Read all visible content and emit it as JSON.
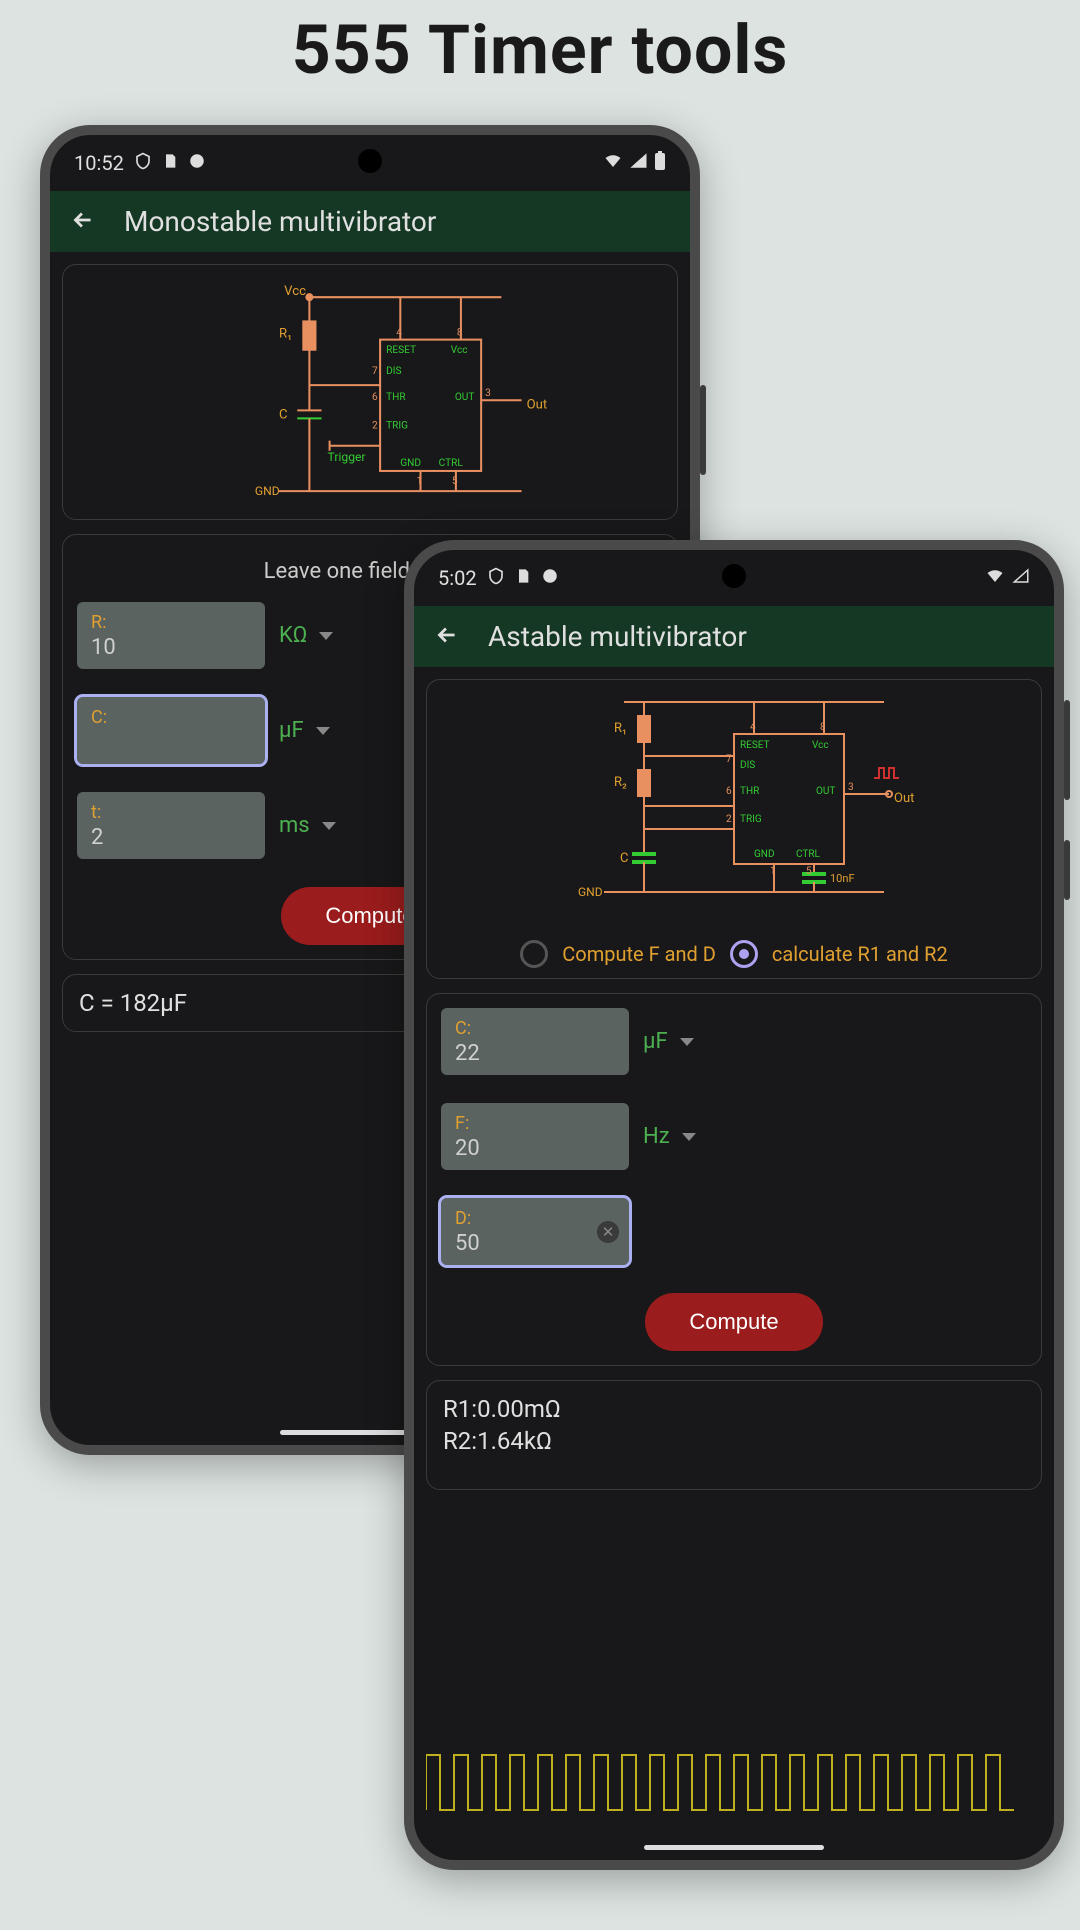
{
  "page_heading": "555 Timer tools",
  "phone1": {
    "status": {
      "time": "10:52"
    },
    "title": "Monostable multivibrator",
    "helper": "Leave one field empty",
    "fields": {
      "r": {
        "label": "R:",
        "value": "10",
        "unit": "KΩ"
      },
      "c": {
        "label": "C:",
        "value": "",
        "unit": "µF"
      },
      "t": {
        "label": "t:",
        "value": "2",
        "unit": "ms"
      }
    },
    "compute_label": "Compute",
    "result": "C = 182µF"
  },
  "phone2": {
    "status": {
      "time": "5:02"
    },
    "title": "Astable multivibrator",
    "radio": {
      "opt1": "Compute F and D",
      "opt2": "calculate R1 and R2"
    },
    "fields": {
      "c": {
        "label": "C:",
        "value": "22",
        "unit": "µF"
      },
      "f": {
        "label": "F:",
        "value": "20",
        "unit": "Hz"
      },
      "d": {
        "label": "D:",
        "value": "50"
      }
    },
    "compute_label": "Compute",
    "results": {
      "r1": "R1:0.00mΩ",
      "r2": "R2:1.64kΩ"
    },
    "circuit_labels": {
      "r1": "R₁",
      "r2": "R₂",
      "c": "C",
      "gnd": "GND",
      "out": "Out",
      "reset": "RESET",
      "vcc": "Vcc",
      "dis": "DIS",
      "thr": "THR",
      "output": "OUT",
      "trig": "TRIG",
      "gnd_pin": "GND",
      "ctrl": "CTRL",
      "cap10n": "10nF"
    }
  },
  "circuit1_labels": {
    "vcc": "Vcc",
    "r1": "R₁",
    "c": "C",
    "trigger": "Trigger",
    "gnd": "GND",
    "out": "Out",
    "reset": "RESET",
    "dis": "DIS",
    "thr": "THR",
    "output": "OUT",
    "trig": "TRIG",
    "gnd_pin": "GND",
    "ctrl": "CTRL",
    "vcc_pin": "Vcc"
  }
}
